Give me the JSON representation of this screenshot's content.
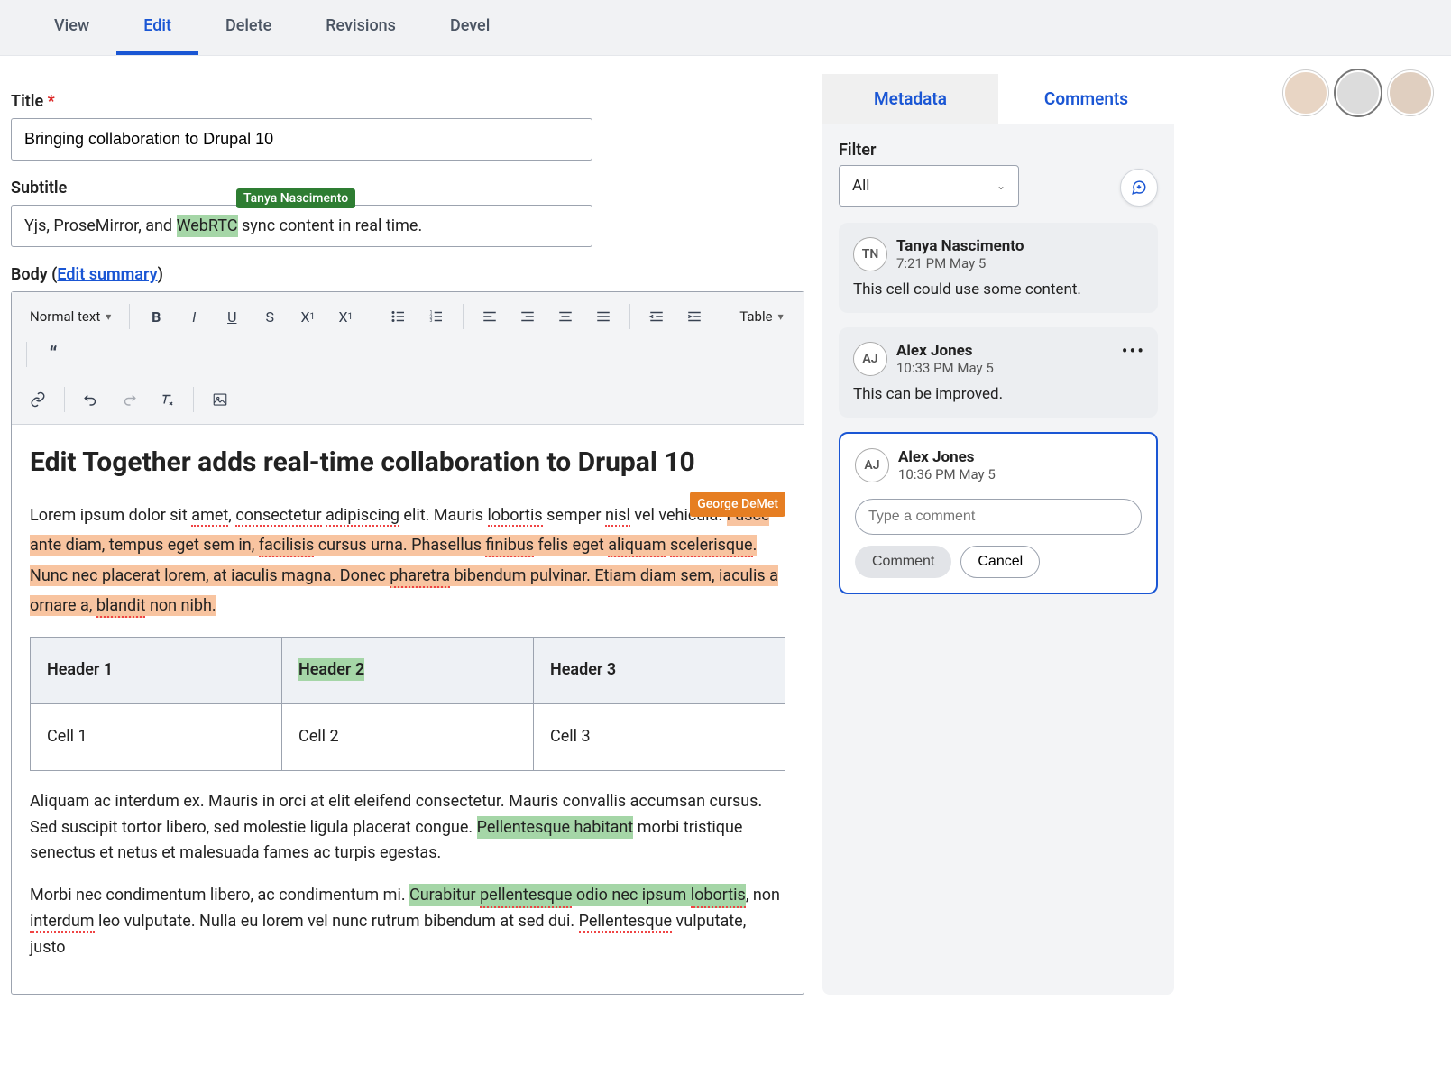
{
  "tabs": [
    "View",
    "Edit",
    "Delete",
    "Revisions",
    "Devel"
  ],
  "active_tab": 1,
  "form": {
    "title_label": "Title",
    "title_value": "Bringing collaboration to Drupal 10",
    "subtitle_label": "Subtitle",
    "subtitle_pre": "Yjs, ProseMirror, and ",
    "subtitle_hl": "WebRTC",
    "subtitle_post": " sync content in real time.",
    "subtitle_tag_name": "Tanya Nascimento",
    "body_label": "Body (",
    "body_link": "Edit summary",
    "body_label_close": ")"
  },
  "toolbar": {
    "paragraph_style": "Normal text",
    "table_label": "Table"
  },
  "content": {
    "h1": "Edit Together adds real-time collaboration to Drupal 10",
    "p1_a": "Lorem ipsum dolor sit ",
    "p1_amet": "amet",
    "p1_b": ", ",
    "p1_cons": "consectetur",
    "p1_c": " ",
    "p1_adip": "adipiscing",
    "p1_d": " elit. Mauris ",
    "p1_lob": "lobortis",
    "p1_e": " semper ",
    "p1_nisl": "nisl",
    "p1_f": " vel vehicula. ",
    "p1_fusce": "Fusce ante",
    "p1_g": " diam, tempus eget sem in, ",
    "p1_fac": "facilisis",
    "p1_h": " cursus urna. Phasellus ",
    "p1_fin": "finibus",
    "p1_i": " felis eget ",
    "p1_ali": "aliquam",
    "p1_j": " ",
    "p1_scel": "scelerisque",
    "p1_k": ". ",
    "p1_hl": "Nunc nec placerat lorem, at iaculis magna. Donec ",
    "p1_phar": "pharetra",
    "p1_hl2": " bibendum pulvinar. Etiam diam sem, iaculis a ornare a, ",
    "p1_bland": "blandit",
    "p1_hl3": " non nibh.",
    "p1_tag_name": "George DeMet",
    "table": {
      "h1": "Header 1",
      "h2": "Header 2",
      "h3": "Header 3",
      "c1": "Cell 1",
      "c2": "Cell 2",
      "c3": "Cell 3"
    },
    "p2_a": "Aliquam ac interdum ex. Mauris in orci at elit eleifend consectetur. Mauris convallis accumsan cursus. Sed suscipit tortor libero, sed molestie ligula placerat congue. ",
    "p2_hl": "Pellentesque habitant",
    "p2_b": " morbi tristique senectus et netus et malesuada fames ac turpis egestas.",
    "p3_a": "Morbi nec condimentum libero, ac condimentum mi. ",
    "p3_hl": "Curabitur ",
    "p3_pell": "pellentesque",
    "p3_hl2": " odio nec ipsum ",
    "p3_lob": "lobortis",
    "p3_b": ", non ",
    "p3_int": "interdum",
    "p3_c": " leo vulputate. Nulla eu lorem vel nunc rutrum bibendum at sed dui. ",
    "p3_pell2": "Pellentesque",
    "p3_d": " vulputate, justo"
  },
  "sidebar": {
    "t1": "Metadata",
    "t2": "Comments",
    "filter_label": "Filter",
    "filter_value": "All",
    "comments": [
      {
        "initials": "TN",
        "name": "Tanya Nascimento",
        "time": "7:21 PM May 5",
        "body": "This cell could use some content."
      },
      {
        "initials": "AJ",
        "name": "Alex Jones",
        "time": "10:33 PM May 5",
        "body": "This can be improved."
      }
    ],
    "new_comment": {
      "initials": "AJ",
      "name": "Alex Jones",
      "time": "10:36 PM May 5",
      "placeholder": "Type a comment",
      "submit": "Comment",
      "cancel": "Cancel"
    }
  }
}
